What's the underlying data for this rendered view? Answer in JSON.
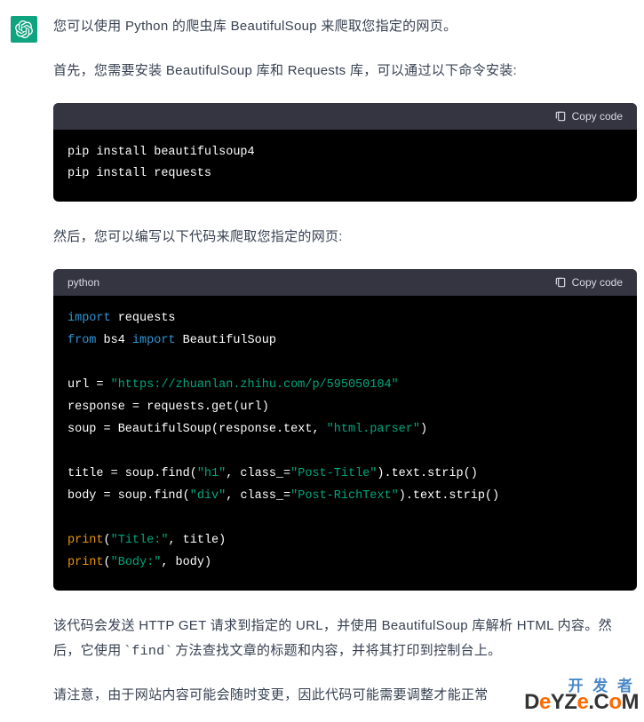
{
  "avatar": {
    "icon": "openai-logo"
  },
  "paragraphs": {
    "p1": "您可以使用 Python 的爬虫库 BeautifulSoup 来爬取您指定的网页。",
    "p2": "首先，您需要安装 BeautifulSoup 库和 Requests 库，可以通过以下命令安装:",
    "p3": "然后，您可以编写以下代码来爬取您指定的网页:",
    "p4_before": "该代码会发送 HTTP GET 请求到指定的 URL，并使用 BeautifulSoup 库解析 HTML 内容。然后，它使用 `",
    "p4_code": "find",
    "p4_after": "` 方法查找文章的标题和内容，并将其打印到控制台上。",
    "p5": "请注意，由于网站内容可能会随时变更，因此代码可能需要调整才能正常"
  },
  "code1": {
    "lang": "",
    "copy_label": "Copy code",
    "lines": {
      "l1": "pip install beautifulsoup4",
      "l2": "pip install requests"
    }
  },
  "code2": {
    "lang": "python",
    "copy_label": "Copy code",
    "tokens": {
      "import": "import",
      "from": "from",
      "requests": " requests",
      "bs4": " bs4 ",
      "BeautifulSoup": " BeautifulSoup",
      "url_assign": "url = ",
      "url_str": "\"https://zhuanlan.zhihu.com/p/595050104\"",
      "response_line": "response = requests.get(url)",
      "soup_pre": "soup = BeautifulSoup(response.text, ",
      "html_parser": "\"html.parser\"",
      "soup_post": ")",
      "title_pre": "title = soup.find(",
      "h1": "\"h1\"",
      "class_eq": ", class_=",
      "post_title": "\"Post-Title\"",
      "title_post": ").text.strip()",
      "body_pre": "body = soup.find(",
      "div": "\"div\"",
      "post_rich": "\"Post-RichText\"",
      "body_post": ").text.strip()",
      "print": "print",
      "print_title_pre": "(",
      "title_label": "\"Title:\"",
      "print_title_post": ", title)",
      "body_label": "\"Body:\"",
      "print_body_post": ", body)"
    }
  },
  "watermark": {
    "line1": "开 发 者",
    "a": "D",
    "b": "e",
    "c": "YZ",
    "d": "e",
    "e": ".C",
    "f": "o",
    "g": "M"
  }
}
